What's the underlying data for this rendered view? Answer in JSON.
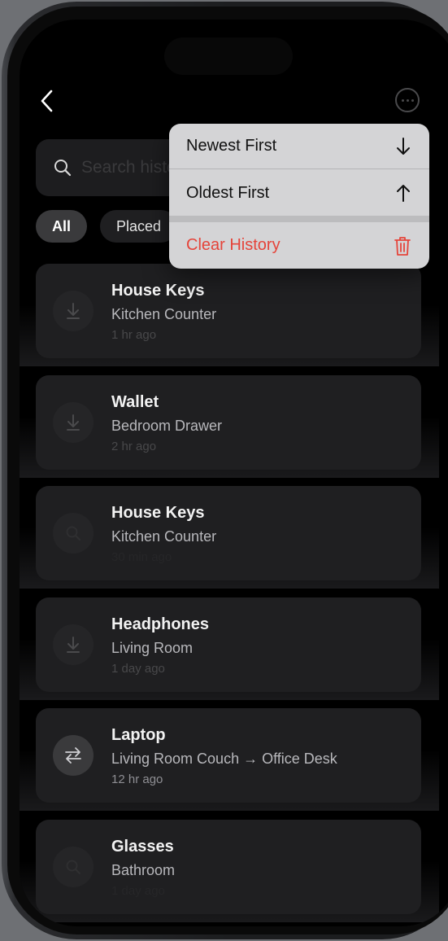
{
  "nav": {
    "back_icon": "chevron-left-icon",
    "more_icon": "ellipsis-circle-icon"
  },
  "search": {
    "placeholder": "Search history",
    "value": ""
  },
  "filters": {
    "items": [
      {
        "label": "All",
        "active": true
      },
      {
        "label": "Placed",
        "active": false
      }
    ]
  },
  "history": [
    {
      "title": "House Keys",
      "location": "Kitchen Counter",
      "time": "1 hr ago",
      "icon": "arrow-down-to-line-icon"
    },
    {
      "title": "Wallet",
      "location": "Bedroom Drawer",
      "time": "2 hr ago",
      "icon": "arrow-down-to-line-icon"
    },
    {
      "title": "House Keys",
      "location": "Kitchen Counter",
      "time": "30 min ago",
      "icon": "search-icon"
    },
    {
      "title": "Headphones",
      "location": "Living Room",
      "time": "1 day ago",
      "icon": "arrow-down-to-line-icon"
    },
    {
      "title": "Laptop",
      "location": "Living Room Couch → Office Desk",
      "time": "12 hr ago",
      "icon": "arrows-left-right-icon"
    },
    {
      "title": "Glasses",
      "location": "Bathroom",
      "time": "1 day ago",
      "icon": "search-icon"
    }
  ],
  "menu": {
    "newest_first": "Newest First",
    "oldest_first": "Oldest First",
    "clear_history": "Clear History"
  },
  "colors": {
    "danger": "#e5443a",
    "menu_bg": "#d4d4d6",
    "card_bg": "#1f1f21"
  }
}
